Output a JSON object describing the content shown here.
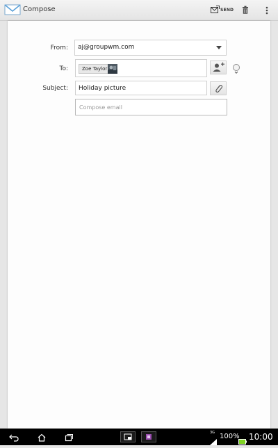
{
  "actionbar": {
    "title": "Compose",
    "send_label": "SEND",
    "icons": [
      "email-app-icon",
      "send-icon",
      "trash-icon",
      "overflow-menu-icon"
    ]
  },
  "form": {
    "from_label": "From:",
    "from_value": "aj@groupwm.com",
    "to_label": "To:",
    "recipient_chip": "Zoe Taylor",
    "subject_label": "Subject:",
    "subject_value": "Holiday picture",
    "compose_placeholder": "Compose email",
    "icons": [
      "dropdown-caret-icon",
      "add-contact-icon",
      "expand-icon",
      "attachment-icon"
    ]
  },
  "status": {
    "network": "3G",
    "battery": "100%",
    "time": "10:00",
    "icons": [
      "back-icon",
      "home-icon",
      "recent-apps-icon",
      "small-apps-icon",
      "app-thumbnail-icon",
      "signal-icon",
      "battery-icon"
    ]
  },
  "colors": {
    "battery_green": "#7ed321",
    "app_icon_blue": "#5aa0d8"
  }
}
